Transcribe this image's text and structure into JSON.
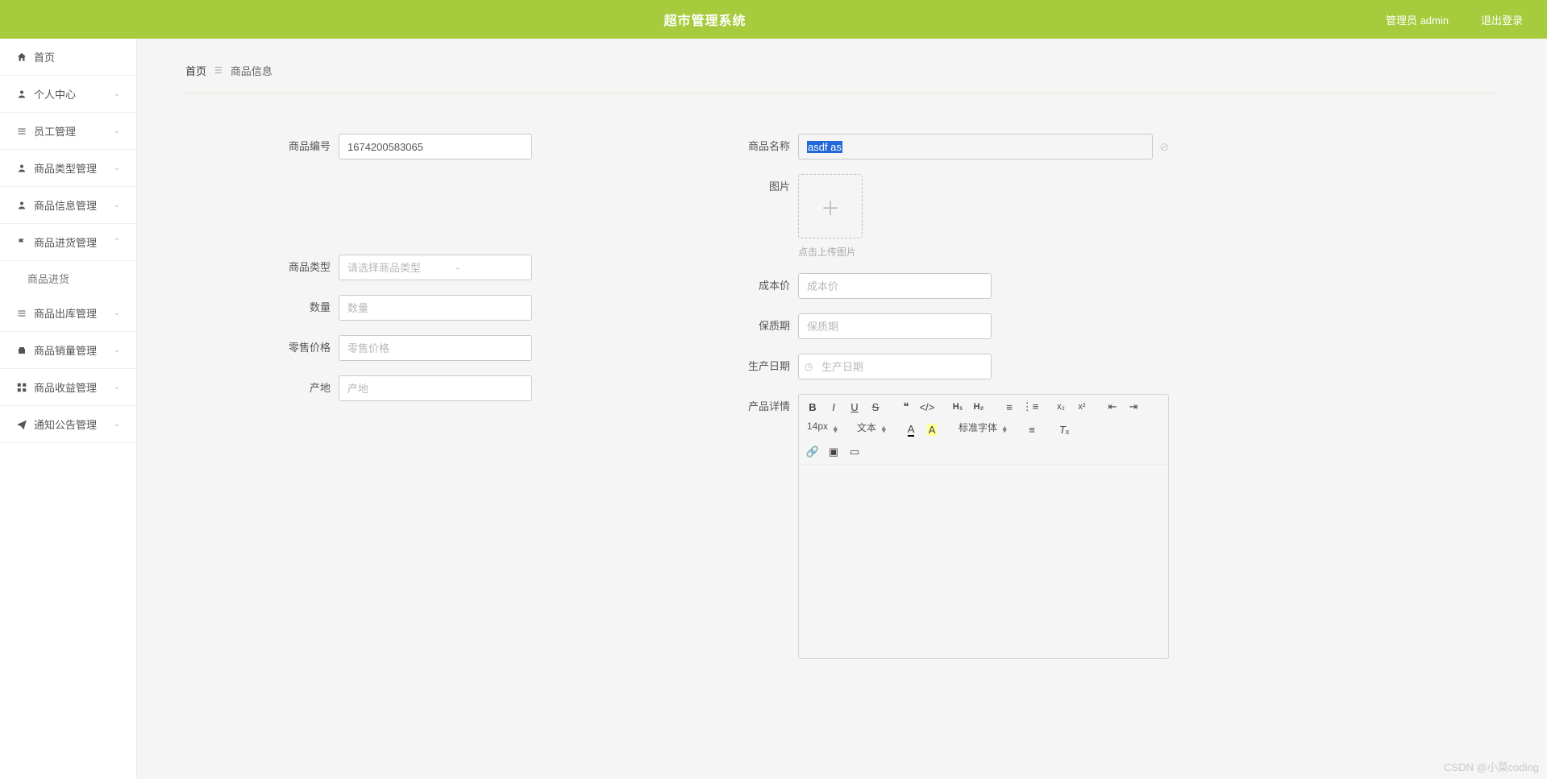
{
  "header": {
    "title": "超市管理系统",
    "admin_label": "管理员 admin",
    "logout_label": "退出登录"
  },
  "sidebar": {
    "items": [
      {
        "label": "首页",
        "icon": "home",
        "expandable": false
      },
      {
        "label": "个人中心",
        "icon": "user",
        "expandable": true,
        "open": false
      },
      {
        "label": "员工管理",
        "icon": "list",
        "expandable": true,
        "open": false
      },
      {
        "label": "商品类型管理",
        "icon": "user",
        "expandable": true,
        "open": false
      },
      {
        "label": "商品信息管理",
        "icon": "user",
        "expandable": true,
        "open": false
      },
      {
        "label": "商品进货管理",
        "icon": "flag",
        "expandable": true,
        "open": true,
        "children": [
          {
            "label": "商品进货"
          }
        ]
      },
      {
        "label": "商品出库管理",
        "icon": "list",
        "expandable": true,
        "open": false
      },
      {
        "label": "商品销量管理",
        "icon": "box",
        "expandable": true,
        "open": false
      },
      {
        "label": "商品收益管理",
        "icon": "grid",
        "expandable": true,
        "open": false
      },
      {
        "label": "通知公告管理",
        "icon": "send",
        "expandable": true,
        "open": false
      }
    ]
  },
  "breadcrumb": {
    "home": "首页",
    "current": "商品信息"
  },
  "form": {
    "product_code": {
      "label": "商品编号",
      "value": "1674200583065"
    },
    "product_name": {
      "label": "商品名称",
      "value": "asdf as"
    },
    "image": {
      "label": "图片",
      "hint": "点击上传图片"
    },
    "product_type": {
      "label": "商品类型",
      "placeholder": "请选择商品类型"
    },
    "quantity": {
      "label": "数量",
      "placeholder": "数量"
    },
    "cost_price": {
      "label": "成本价",
      "placeholder": "成本价"
    },
    "retail_price": {
      "label": "零售价格",
      "placeholder": "零售价格"
    },
    "shelf_life": {
      "label": "保质期",
      "placeholder": "保质期"
    },
    "origin": {
      "label": "产地",
      "placeholder": "产地"
    },
    "production_date": {
      "label": "生产日期",
      "placeholder": "生产日期"
    },
    "product_detail": {
      "label": "产品详情"
    }
  },
  "editor_toolbar": {
    "font_size": "14px",
    "block_type": "文本",
    "font_family": "标准字体"
  },
  "watermark": "CSDN @小菜coding"
}
